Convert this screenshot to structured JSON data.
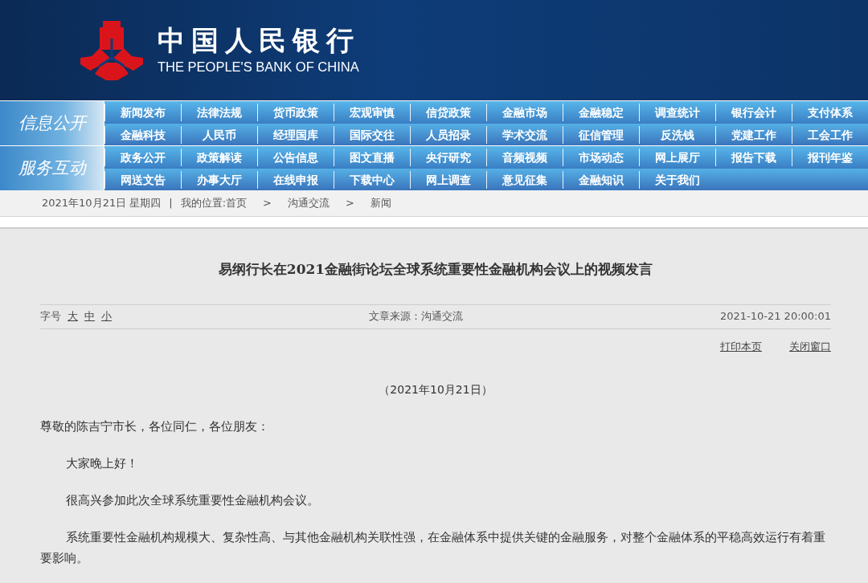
{
  "header": {
    "logo_title": "中国人民银行",
    "logo_subtitle": "THE PEOPLE'S BANK OF CHINA"
  },
  "nav_groups": [
    {
      "label": "信息公开",
      "items": [
        "新闻发布",
        "法律法规",
        "货币政策",
        "宏观审慎",
        "信贷政策",
        "金融市场",
        "金融稳定",
        "调查统计",
        "银行会计",
        "支付体系",
        "金融科技",
        "人民币",
        "经理国库",
        "国际交往",
        "人员招录",
        "学术交流",
        "征信管理",
        "反洗钱",
        "党建工作",
        "工会工作"
      ]
    },
    {
      "label": "服务互动",
      "items": [
        "政务公开",
        "政策解读",
        "公告信息",
        "图文直播",
        "央行研究",
        "音频视频",
        "市场动态",
        "网上展厅",
        "报告下载",
        "报刊年鉴",
        "网送文告",
        "办事大厅",
        "在线申报",
        "下载中心",
        "网上调查",
        "意见征集",
        "金融知识",
        "关于我们"
      ]
    }
  ],
  "breadcrumb": {
    "date": "2021年10月21日 星期四",
    "divider": "|",
    "label": "我的位置:",
    "separator": ">",
    "crumbs": [
      "首页",
      "沟通交流",
      "新闻"
    ]
  },
  "article": {
    "title": "易纲行长在2021金融街论坛全球系统重要性金融机构会议上的视频发言",
    "font_size_label": "字号",
    "font_sizes": [
      "大",
      "中",
      "小"
    ],
    "source": "文章来源：沟通交流",
    "datetime": "2021-10-21 20:00:01",
    "actions": [
      "打印本页",
      "关闭窗口"
    ],
    "date_line": "（2021年10月21日）",
    "salutation": "尊敬的陈吉宁市长，各位同仁，各位朋友：",
    "paragraphs": [
      "大家晚上好！",
      "很高兴参加此次全球系统重要性金融机构会议。",
      "系统重要性金融机构规模大、复杂性高、与其他金融机构关联性强，在金融体系中提供关键的金融服务，对整个金融体系的平稳高效运行有着重要影响。"
    ]
  }
}
